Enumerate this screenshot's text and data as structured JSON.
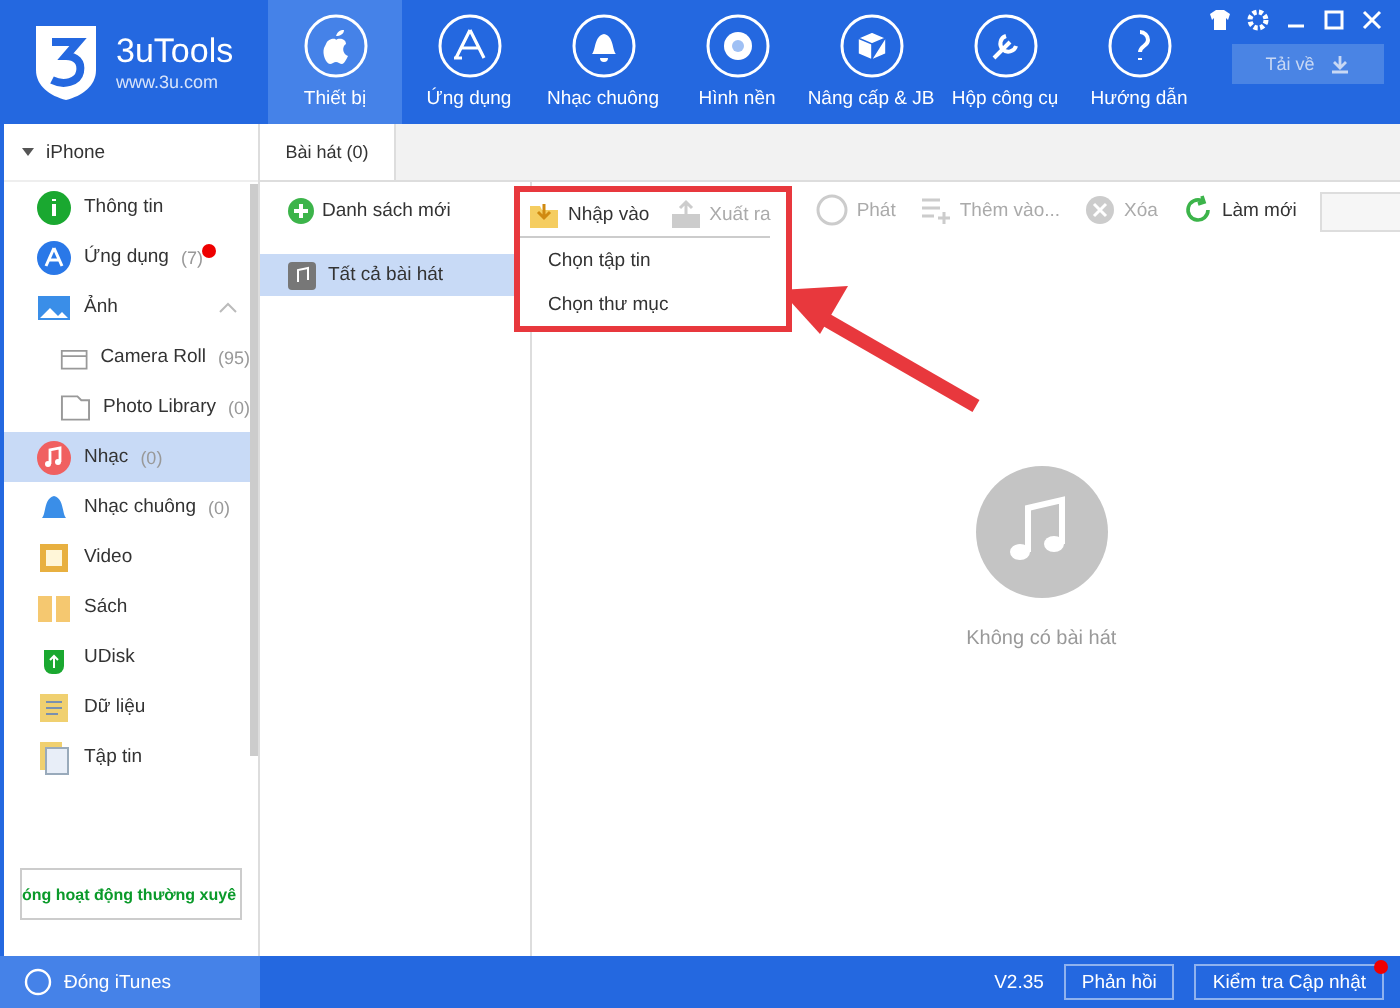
{
  "app": {
    "name": "3uTools",
    "url": "www.3u.com"
  },
  "nav": [
    {
      "label": "Thiết bị",
      "selected": true
    },
    {
      "label": "Ứng dụng",
      "selected": false
    },
    {
      "label": "Nhạc chuông",
      "selected": false
    },
    {
      "label": "Hình nền",
      "selected": false
    },
    {
      "label": "Nâng cấp & JB",
      "selected": false
    },
    {
      "label": "Hộp công cụ",
      "selected": false
    },
    {
      "label": "Hướng dẫn",
      "selected": false
    }
  ],
  "download_button": {
    "label": "Tải về"
  },
  "sidebar": {
    "device": "iPhone",
    "items": [
      {
        "label": "Thông tin",
        "selected": false
      },
      {
        "label": "Ứng dụng",
        "count": "(7)",
        "badge": true,
        "selected": false
      },
      {
        "label": "Ảnh",
        "selected": false,
        "expanded": true,
        "children": [
          {
            "label": "Camera Roll",
            "count": "(95)",
            "selected": false
          },
          {
            "label": "Photo Library",
            "count": "(0)",
            "selected": false
          }
        ]
      },
      {
        "label": "Nhạc",
        "count": "(0)",
        "selected": true
      },
      {
        "label": "Nhạc chuông",
        "count": "(0)",
        "selected": false
      },
      {
        "label": "Video",
        "selected": false
      },
      {
        "label": "Sách",
        "selected": false
      },
      {
        "label": "UDisk",
        "selected": false
      },
      {
        "label": "Dữ liệu",
        "selected": false
      },
      {
        "label": "Tập tin",
        "selected": false
      }
    ],
    "marquee": "óng hoạt động thường xuyê"
  },
  "tabs": [
    {
      "label": "Bài hát (0)",
      "selected": true
    }
  ],
  "new_playlist": "Danh sách mới",
  "playlists": [
    {
      "label": "Tất cả bài hát",
      "selected": true
    }
  ],
  "toolbar": [
    {
      "label": "Nhập vào",
      "disabled": false
    },
    {
      "label": "Xuất ra",
      "disabled": true
    },
    {
      "label": "Phát",
      "disabled": true
    },
    {
      "label": "Thêm vào...",
      "disabled": true
    },
    {
      "label": "Xóa",
      "disabled": true
    },
    {
      "label": "Làm mới",
      "disabled": false
    }
  ],
  "dropdown": [
    "Chọn tập tin",
    "Chọn thư mục"
  ],
  "empty_state": "Không có bài hát",
  "footer": {
    "itunes": "Đóng iTunes",
    "version": "V2.35",
    "buttons": [
      {
        "label": "Phản hồi",
        "badge": false
      },
      {
        "label": "Kiểm tra Cập nhật",
        "badge": true
      }
    ]
  }
}
